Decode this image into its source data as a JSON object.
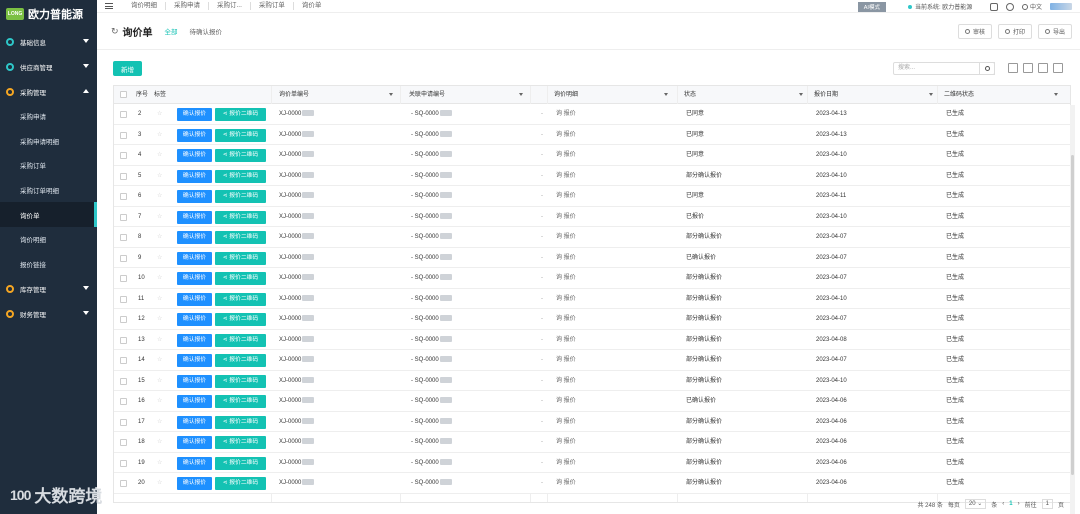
{
  "brand": {
    "logo_badge": "LONG",
    "name": "欧力普能源"
  },
  "sidebar": {
    "groups": [
      {
        "label": "基础信息",
        "expanded": false
      },
      {
        "label": "供应商管理",
        "expanded": false
      },
      {
        "label": "采购管理",
        "expanded": true
      },
      {
        "label": "库存管理",
        "expanded": false
      },
      {
        "label": "财务管理",
        "expanded": false
      }
    ],
    "purchase_items": [
      "采购申请",
      "采购申请明细",
      "采购订单",
      "采购订单明细",
      "询价单",
      "询价明细",
      "报价链接"
    ],
    "active_item": "询价单"
  },
  "topnav": {
    "breadcrumbs": [
      "询价明细",
      "采购申请",
      "采购订...",
      "采购订单",
      "询价单"
    ],
    "ai_badge": "AI模式",
    "system_label": "当前系统: 欧力普能源",
    "language": "中文"
  },
  "page": {
    "title": "询价单",
    "tabs": [
      "全部",
      "待确认报价"
    ],
    "actions": {
      "audit": "审核",
      "print": "打印",
      "export": "导出"
    },
    "add_label": "新增",
    "search_placeholder": "搜索..."
  },
  "table": {
    "headers": [
      "序号",
      "标签",
      "询价单编号",
      "关联申请编号",
      "询价明细",
      "状态",
      "报价日期",
      "二维码状态"
    ],
    "btn_confirm": "确认报价",
    "btn_qr": "报价二维码",
    "detail_text": "询 报价",
    "rows": [
      {
        "no": "2",
        "code": "XJ-0000",
        "req": "- SQ-0000",
        "status": "已同意",
        "date": "2023-04-13",
        "qr": "已生成"
      },
      {
        "no": "3",
        "code": "XJ-0000",
        "req": "- SQ-0000",
        "status": "已同意",
        "date": "2023-04-13",
        "qr": "已生成"
      },
      {
        "no": "4",
        "code": "XJ-0000",
        "req": "- SQ-0000",
        "status": "已同意",
        "date": "2023-04-10",
        "qr": "已生成"
      },
      {
        "no": "5",
        "code": "XJ-0000",
        "req": "- SQ-0000",
        "status": "部分确认报价",
        "date": "2023-04-10",
        "qr": "已生成"
      },
      {
        "no": "6",
        "code": "XJ-0000",
        "req": "- SQ-0000",
        "status": "已同意",
        "date": "2023-04-11",
        "qr": "已生成"
      },
      {
        "no": "7",
        "code": "XJ-0000",
        "req": "- SQ-0000",
        "status": "已报价",
        "date": "2023-04-10",
        "qr": "已生成"
      },
      {
        "no": "8",
        "code": "XJ-0000",
        "req": "- SQ-0000",
        "status": "部分确认报价",
        "date": "2023-04-07",
        "qr": "已生成"
      },
      {
        "no": "9",
        "code": "XJ-0000",
        "req": "- SQ-0000",
        "status": "已确认报价",
        "date": "2023-04-07",
        "qr": "已生成"
      },
      {
        "no": "10",
        "code": "XJ-0000",
        "req": "- SQ-0000",
        "status": "部分确认报价",
        "date": "2023-04-07",
        "qr": "已生成"
      },
      {
        "no": "11",
        "code": "XJ-0000",
        "req": "- SQ-0000",
        "status": "部分确认报价",
        "date": "2023-04-10",
        "qr": "已生成"
      },
      {
        "no": "12",
        "code": "XJ-0000",
        "req": "- SQ-0000",
        "status": "部分确认报价",
        "date": "2023-04-07",
        "qr": "已生成"
      },
      {
        "no": "13",
        "code": "XJ-0000",
        "req": "- SQ-0000",
        "status": "部分确认报价",
        "date": "2023-04-08",
        "qr": "已生成"
      },
      {
        "no": "14",
        "code": "XJ-0000",
        "req": "- SQ-0000",
        "status": "部分确认报价",
        "date": "2023-04-07",
        "qr": "已生成"
      },
      {
        "no": "15",
        "code": "XJ-0000",
        "req": "- SQ-0000",
        "status": "部分确认报价",
        "date": "2023-04-10",
        "qr": "已生成"
      },
      {
        "no": "16",
        "code": "XJ-0000",
        "req": "- SQ-0000",
        "status": "已确认报价",
        "date": "2023-04-06",
        "qr": "已生成"
      },
      {
        "no": "17",
        "code": "XJ-0000",
        "req": "- SQ-0000",
        "status": "部分确认报价",
        "date": "2023-04-06",
        "qr": "已生成"
      },
      {
        "no": "18",
        "code": "XJ-0000",
        "req": "- SQ-0000",
        "status": "部分确认报价",
        "date": "2023-04-06",
        "qr": "已生成"
      },
      {
        "no": "19",
        "code": "XJ-0000",
        "req": "- SQ-0000",
        "status": "部分确认报价",
        "date": "2023-04-06",
        "qr": "已生成"
      },
      {
        "no": "20",
        "code": "XJ-0000",
        "req": "- SQ-0000",
        "status": "部分确认报价",
        "date": "2023-04-06",
        "qr": "已生成"
      }
    ]
  },
  "pagination": {
    "total_text": "共 248 条",
    "per_page_label": "每页",
    "page_size": "20",
    "unit_label": "条",
    "goto_label": "前往",
    "current_page": "1",
    "page_unit": "页"
  },
  "watermark": {
    "logo": "100",
    "text": "大数跨境"
  }
}
